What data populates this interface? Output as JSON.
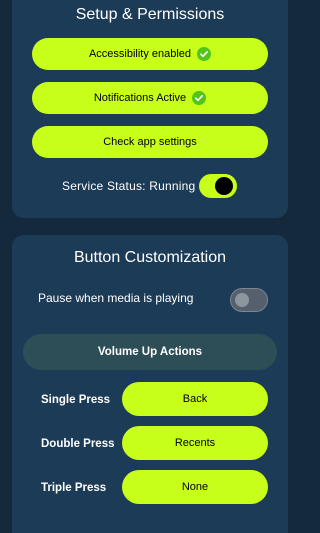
{
  "permissions": {
    "title": "Setup & Permissions",
    "accessibility_label": "Accessibility enabled",
    "notifications_label": "Notifications Active",
    "check_settings_label": "Check app settings",
    "service_status_label": "Service Status: Running",
    "service_toggle_on": true
  },
  "customization": {
    "title": "Button Customization",
    "pause_media_label": "Pause when media is playing",
    "pause_media_on": false,
    "section_title": "Volume Up Actions",
    "actions": [
      {
        "label": "Single Press",
        "value": "Back"
      },
      {
        "label": "Double Press",
        "value": "Recents"
      },
      {
        "label": "Triple Press",
        "value": "None"
      }
    ]
  },
  "colors": {
    "background": "#15293d",
    "card": "#1c3b57",
    "accent": "#c8ff1a",
    "check": "#52c41a"
  }
}
